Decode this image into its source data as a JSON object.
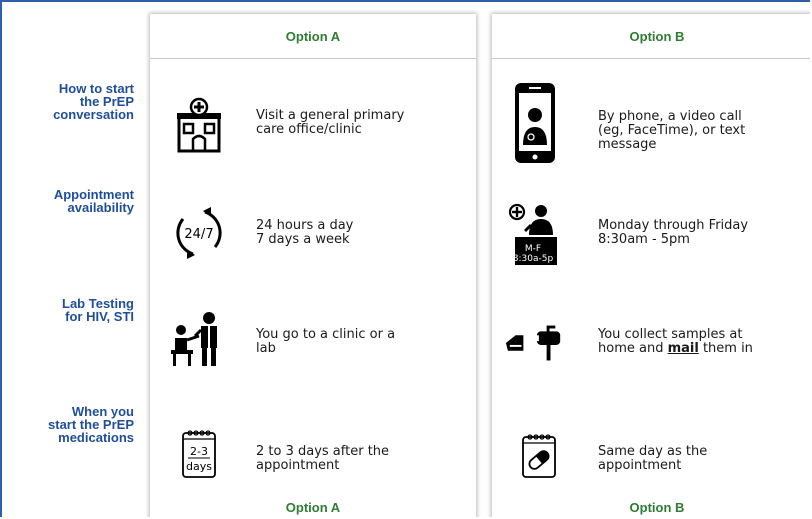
{
  "columns": {
    "option_a": "Option A",
    "option_b": "Option B"
  },
  "rows": [
    {
      "label": "How to start\nthe PrEP\nconversation",
      "a_text": "Visit a general primary\ncare office/clinic",
      "a_icon": "clinic-building-icon",
      "b_text": "By phone, a video call\n(eg, FaceTime), or text\nmessage",
      "b_icon": "smartphone-doctor-icon"
    },
    {
      "label": "Appointment\navailability",
      "a_text": "24 hours a day\n7 days a week",
      "a_icon": "24-7-icon",
      "a_icon_text": "24/7",
      "b_text": "Monday through Friday\n8:30am - 5pm",
      "b_icon": "doctor-hours-icon",
      "b_icon_line1": "M-F",
      "b_icon_line2": "8:30a-5p"
    },
    {
      "label": "Lab Testing\nfor HIV, STI",
      "a_text": "You go to a clinic or a\nlab",
      "a_icon": "lab-visit-icon",
      "b_text_pre": "You collect samples at\nhome and ",
      "b_text_bold": "mail",
      "b_text_post": " them in",
      "b_icon": "mailbox-icon"
    },
    {
      "label": "When you\nstart the PrEP\nmedications",
      "a_text": "2 to 3 days after the\nappointment",
      "a_icon": "calendar-days-icon",
      "a_icon_line1": "2-3",
      "a_icon_line2": "days",
      "b_text": "Same day as the\nappointment",
      "b_icon": "calendar-pill-icon"
    }
  ],
  "colors": {
    "row_label": "#1f4e9a",
    "option_header": "#2e7d32",
    "frame_border": "#2e5fa8"
  }
}
